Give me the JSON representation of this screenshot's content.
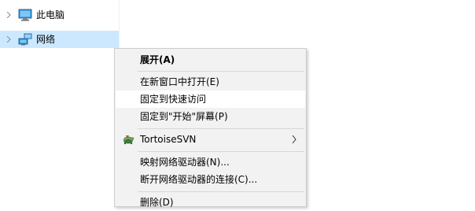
{
  "nav": {
    "items": [
      {
        "label": "此电脑",
        "icon": "computer-icon",
        "selected": false
      },
      {
        "label": "网络",
        "icon": "network-icon",
        "selected": true
      }
    ]
  },
  "context_menu": {
    "items": [
      {
        "label": "展开(A)",
        "bold": true
      },
      {
        "label": "在新窗口中打开(E)"
      },
      {
        "label": "固定到快速访问",
        "highlighted": true
      },
      {
        "label": "固定到\"开始\"屏幕(P)"
      },
      {
        "label": "TortoiseSVN",
        "icon": "tortoisesvn-icon",
        "submenu": true
      },
      {
        "label": "映射网络驱动器(N)..."
      },
      {
        "label": "断开网络驱动器的连接(C)..."
      },
      {
        "label": "删除(D)"
      }
    ]
  },
  "colors": {
    "selection": "#cce8ff",
    "menu_background": "#f2f2f2",
    "menu_hover": "#ffffff",
    "separator": "#d7d7d7"
  }
}
